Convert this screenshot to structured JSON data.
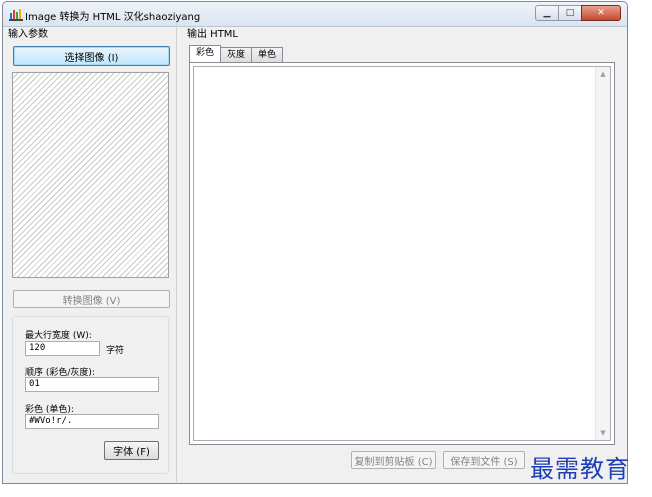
{
  "window": {
    "title": "Image 转换为 HTML   汉化shaoziyang",
    "controls": [
      "minimize-icon",
      "maximize-icon",
      "close-icon"
    ]
  },
  "left": {
    "section_label": "输入参数",
    "select_image_button": "选择图像 (I)",
    "convert_button": "转换图像 (V)",
    "max_width_label": "最大行宽度 (W):",
    "max_width_value": "120",
    "max_width_unit": "字符",
    "order_label": "顺序 (彩色/灰度):",
    "order_value": "01",
    "color_label": "彩色 (单色):",
    "color_value": "#WVo!r/.",
    "font_button": "字体 (F)"
  },
  "right": {
    "section_label": "输出 HTML",
    "tabs": [
      {
        "label": "彩色",
        "active": true
      },
      {
        "label": "灰度",
        "active": false
      },
      {
        "label": "单色",
        "active": false
      }
    ],
    "output_text": "",
    "copy_button": "复制到剪贴板 (C)",
    "save_button": "保存到文件 (S)"
  },
  "watermark": "最需教育"
}
